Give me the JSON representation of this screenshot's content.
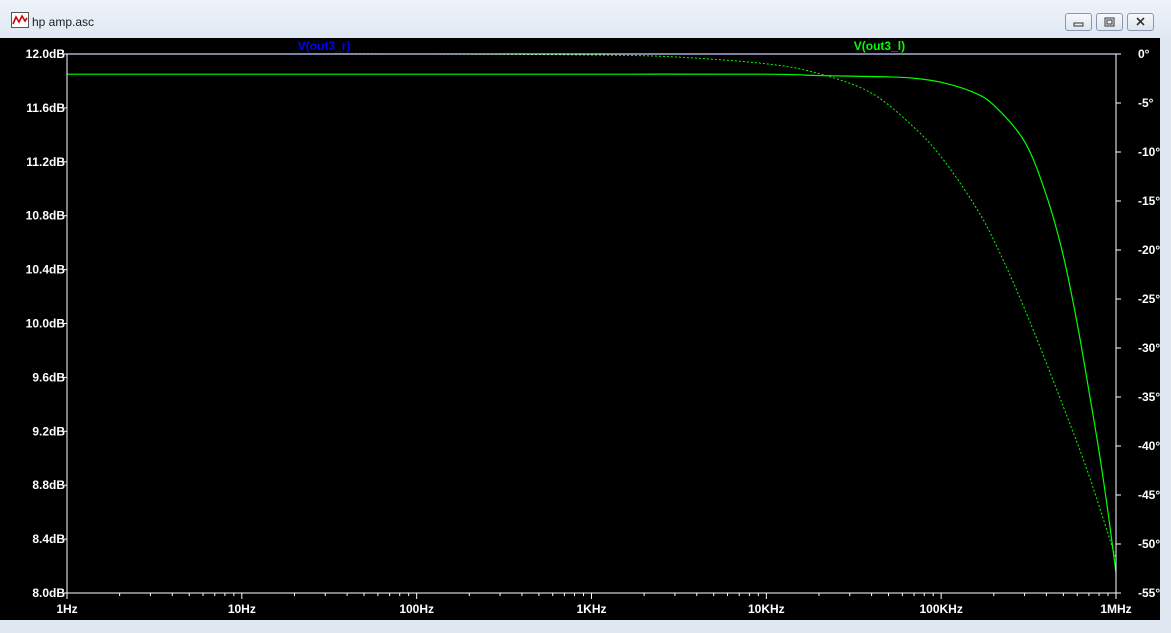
{
  "window": {
    "title": "hp amp.asc",
    "icon": "waveform-icon",
    "buttons": [
      "minimize-icon",
      "restore-icon",
      "close-icon"
    ]
  },
  "colors": {
    "background": "#000000",
    "axis": "#ffffff",
    "trace_r": "#0000ff",
    "trace_l": "#00ff00"
  },
  "chart_data": {
    "type": "line",
    "x_scale": "log",
    "xlim": [
      "1Hz",
      "1MHz"
    ],
    "x_ticks": [
      "1Hz",
      "10Hz",
      "100Hz",
      "1KHz",
      "10KHz",
      "100KHz",
      "1MHz"
    ],
    "left_axis": {
      "unit": "dB",
      "ylim": [
        8.0,
        12.0
      ],
      "ticks": [
        "12.0dB",
        "11.6dB",
        "11.2dB",
        "10.8dB",
        "10.4dB",
        "10.0dB",
        "9.6dB",
        "9.2dB",
        "8.8dB",
        "8.4dB",
        "8.0dB"
      ]
    },
    "right_axis": {
      "unit": "°",
      "ylim": [
        -55,
        0
      ],
      "ticks": [
        "0°",
        "-5°",
        "-10°",
        "-15°",
        "-20°",
        "-25°",
        "-30°",
        "-35°",
        "-40°",
        "-45°",
        "-50°",
        "-55°"
      ]
    },
    "series": [
      {
        "name": "V(out3_r)",
        "color": "#0000ff",
        "magnitude_style": "solid",
        "phase_style": "dotted",
        "x_hz": [
          1,
          10,
          100,
          1000,
          10000,
          100000,
          1000000
        ],
        "magnitude_db": [
          12.0,
          12.0,
          12.0,
          12.0,
          12.0,
          12.0,
          12.0
        ],
        "phase_deg": [
          0,
          0,
          0,
          0,
          0,
          0,
          0
        ]
      },
      {
        "name": "V(out3_l)",
        "color": "#00ff00",
        "magnitude_style": "solid",
        "phase_style": "dotted",
        "x_hz": [
          1,
          10,
          100,
          1000,
          10000,
          20000,
          50000,
          70000,
          100000,
          150000,
          200000,
          300000,
          400000,
          500000,
          600000,
          700000,
          800000,
          900000,
          1000000
        ],
        "magnitude_db": [
          11.85,
          11.85,
          11.85,
          11.85,
          11.85,
          11.84,
          11.83,
          11.82,
          11.79,
          11.72,
          11.62,
          11.35,
          10.95,
          10.5,
          10.0,
          9.5,
          9.05,
          8.6,
          8.15
        ],
        "phase_x_hz": [
          1,
          10,
          100,
          1000,
          3000,
          10000,
          20000,
          40000,
          70000,
          100000,
          150000,
          200000,
          300000,
          500000,
          700000,
          1000000
        ],
        "phase_deg": [
          0,
          0,
          0,
          -0.1,
          -0.3,
          -1,
          -2,
          -4,
          -7.5,
          -10.5,
          -15,
          -19,
          -26,
          -36,
          -43,
          -51.5
        ]
      }
    ]
  }
}
